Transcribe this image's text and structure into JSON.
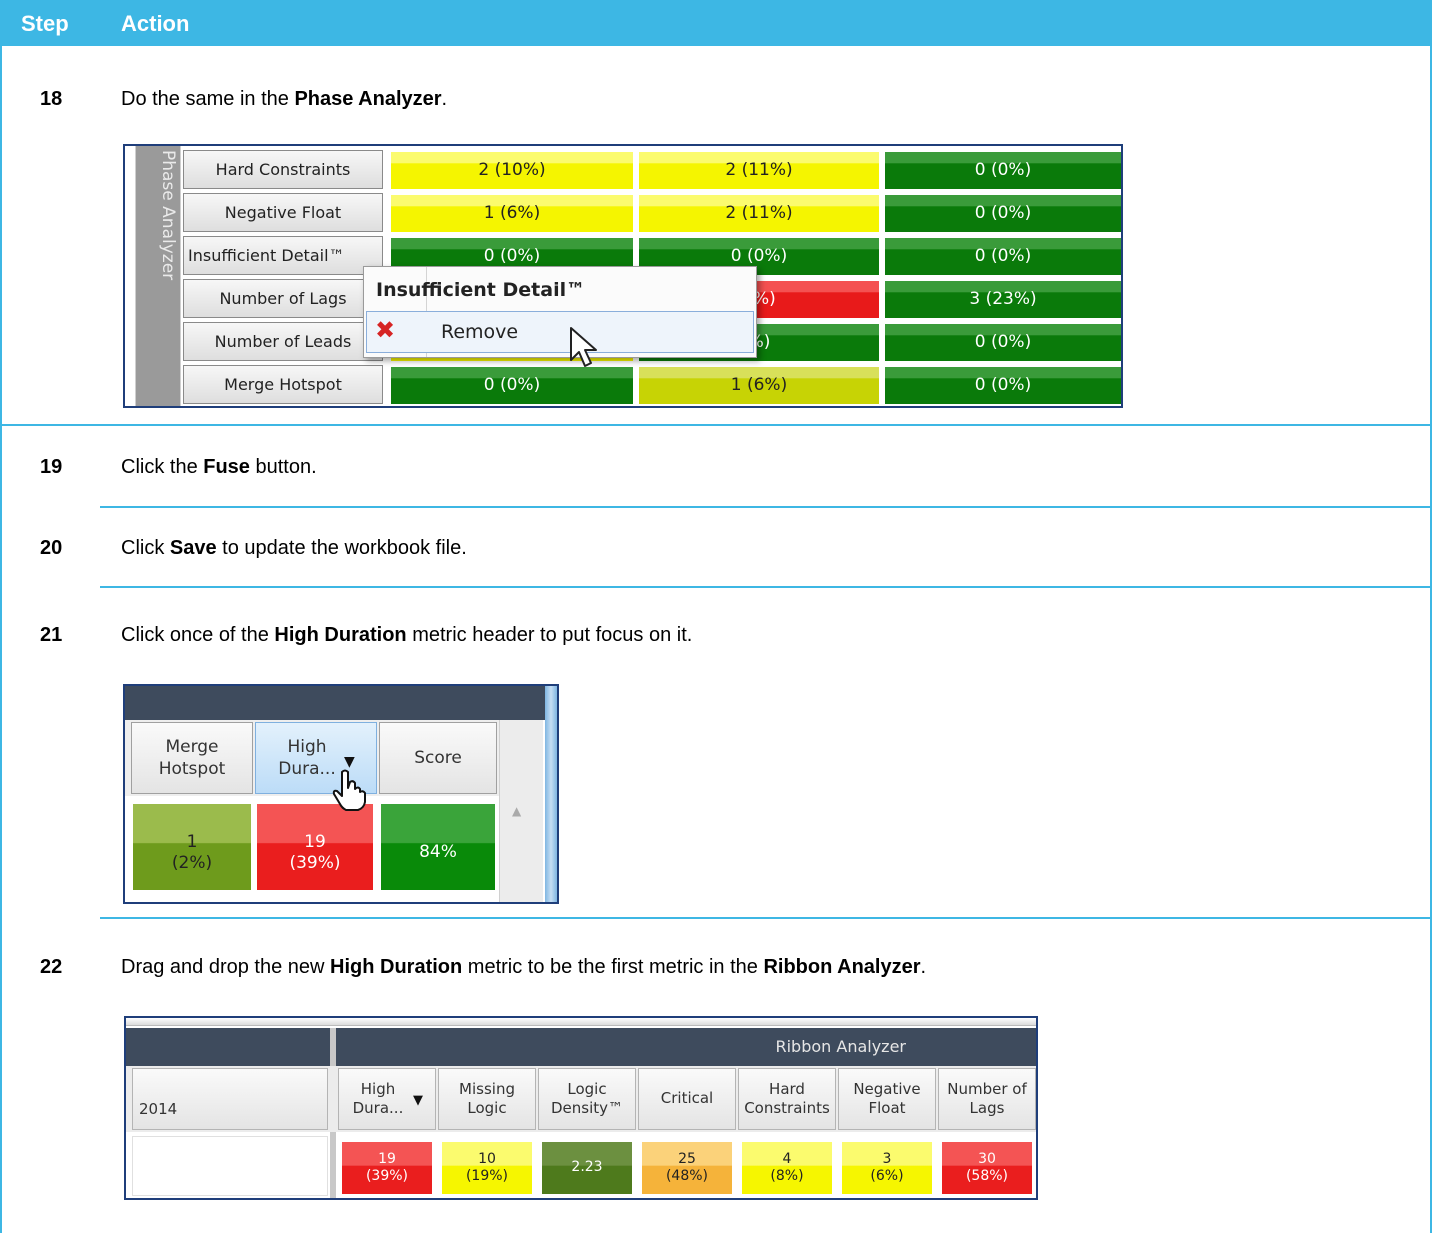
{
  "table": {
    "col_step": "Step",
    "col_action": "Action"
  },
  "steps": [
    {
      "num": "18",
      "pre": "Do the same in the ",
      "bold": "Phase Analyzer",
      "post": "."
    },
    {
      "num": "19",
      "pre": "Click the ",
      "bold": "Fuse",
      "post": " button."
    },
    {
      "num": "20",
      "pre": "Click ",
      "bold": "Save",
      "post": " to update the workbook file."
    },
    {
      "num": "21",
      "pre": "Click once of the ",
      "bold": "High Duration",
      "post": " metric header to put focus on it."
    },
    {
      "num": "22",
      "pre": "Drag and drop the new ",
      "bold": "High Duration",
      "mid": " metric to be the first metric in the ",
      "bold2": "Ribbon Analyzer",
      "post": "."
    }
  ],
  "phase_analyzer": {
    "side_label": "Phase Analyzer",
    "metrics": [
      "Hard Constraints",
      "Negative Float",
      "Insufficient Detail™",
      "Number of Lags",
      "Number of Leads",
      "Merge Hotspot"
    ],
    "rows": [
      [
        {
          "v": "2 (10%)",
          "c": "y"
        },
        {
          "v": "2 (11%)",
          "c": "y"
        },
        {
          "v": "0 (0%)",
          "c": "g"
        }
      ],
      [
        {
          "v": "1 (6%)",
          "c": "y"
        },
        {
          "v": "2 (11%)",
          "c": "y"
        },
        {
          "v": "0 (0%)",
          "c": "g"
        }
      ],
      [
        {
          "v": "0 (0%)",
          "c": "g"
        },
        {
          "v": "0 (0%)",
          "c": "g"
        },
        {
          "v": "0 (0%)",
          "c": "g"
        }
      ],
      [
        {
          "v": "",
          "c": "g"
        },
        {
          "v": "2%)",
          "c": "r"
        },
        {
          "v": "3 (23%)",
          "c": "g"
        }
      ],
      [
        {
          "v": "",
          "c": "y"
        },
        {
          "v": "%)",
          "c": "g"
        },
        {
          "v": "0 (0%)",
          "c": "g"
        }
      ],
      [
        {
          "v": "0 (0%)",
          "c": "g"
        },
        {
          "v": "1 (6%)",
          "c": "lg"
        },
        {
          "v": "0 (0%)",
          "c": "g"
        }
      ]
    ],
    "context_menu": {
      "title": "Insufficient Detail™",
      "remove_label": "Remove",
      "remove_icon": "red-x-icon"
    }
  },
  "high_duration_shot": {
    "headers": [
      "Merge\nHotspot",
      "High\nDura...",
      "Score"
    ],
    "values": [
      {
        "top": "1",
        "bottom": "(2%)",
        "c": "og"
      },
      {
        "top": "19",
        "bottom": "(39%)",
        "c": "r2"
      },
      {
        "top": "84%",
        "bottom": "",
        "c": "g2"
      }
    ]
  },
  "ribbon_shot": {
    "group_title": "Ribbon Analyzer",
    "left_header": "2014",
    "headers": [
      "High\nDura...",
      "Missing\nLogic",
      "Logic\nDensity™",
      "Critical",
      "Hard\nConstraints",
      "Negative\nFloat",
      "Number of\nLags"
    ],
    "values": [
      {
        "top": "19",
        "bottom": "(39%)",
        "c": "r2"
      },
      {
        "top": "10",
        "bottom": "(19%)",
        "c": "y2"
      },
      {
        "top": "2.23",
        "bottom": "",
        "c": "dk"
      },
      {
        "top": "25",
        "bottom": "(48%)",
        "c": "or"
      },
      {
        "top": "4",
        "bottom": "(8%)",
        "c": "y2"
      },
      {
        "top": "3",
        "bottom": "(6%)",
        "c": "y2"
      },
      {
        "top": "30",
        "bottom": "(58%)",
        "c": "r2"
      }
    ]
  }
}
